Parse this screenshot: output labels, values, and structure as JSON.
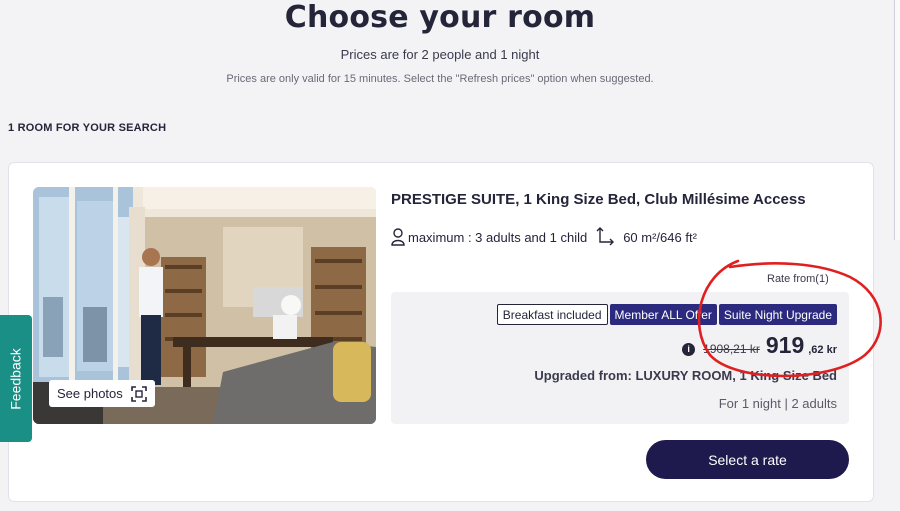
{
  "header": {
    "title": "Choose your room",
    "subtitle": "Prices are for 2 people and 1 night",
    "note": "Prices are only valid for 15 minutes. Select the \"Refresh prices\" option when suggested."
  },
  "section_label": "1 ROOM FOR YOUR SEARCH",
  "room": {
    "see_photos_label": "See photos",
    "name": "PRESTIGE SUITE, 1 King Size Bed, Club Millésime Access",
    "occupancy": "maximum : 3 adults and 1 child",
    "size": "60 m²/646 ft²",
    "rate_from_label": "Rate from(1)",
    "tags": [
      "Breakfast included",
      "Member ALL Offer",
      "Suite Night Upgrade"
    ],
    "old_price": "1908,21 kr",
    "price_main": "919",
    "price_cents": ",62 kr",
    "upgraded_from": "Upgraded from: LUXURY ROOM, 1 King Size Bed",
    "per_text": "For 1 night | 2 adults",
    "select_label": "Select a rate"
  },
  "feedback_label": "Feedback",
  "colors": {
    "navy": "#1e1a4d",
    "tag_filled": "#2c2a7e",
    "feedback": "#1a8f86",
    "annotation": "#e02020"
  },
  "icons": {
    "person": "person-icon",
    "area": "area-icon",
    "scan": "scan-icon",
    "info": "info-icon"
  }
}
